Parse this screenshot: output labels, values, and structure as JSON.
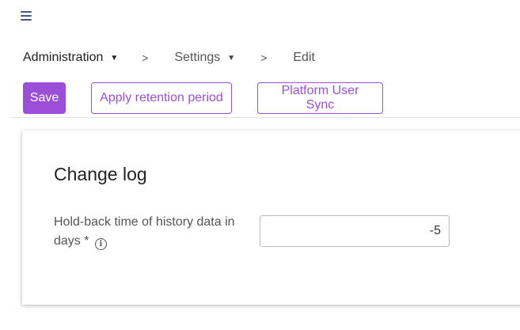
{
  "header": {
    "menu_icon": "hamburger-menu-icon"
  },
  "breadcrumb": {
    "items": [
      {
        "label": "Administration",
        "has_dropdown": true
      },
      {
        "label": "Settings",
        "has_dropdown": true
      },
      {
        "label": "Edit",
        "has_dropdown": false
      }
    ],
    "separator": ">",
    "dropdown_glyph": "▼"
  },
  "toolbar": {
    "save_label": "Save",
    "retention_label": "Apply retention period",
    "sync_label": "Platform User Sync"
  },
  "card": {
    "title": "Change log",
    "field": {
      "label": "Hold-back time of history data in days *",
      "info_glyph": "i",
      "value": "-5"
    }
  },
  "colors": {
    "accent": "#9b4fd8",
    "menu_icon": "#3c5a7a"
  }
}
